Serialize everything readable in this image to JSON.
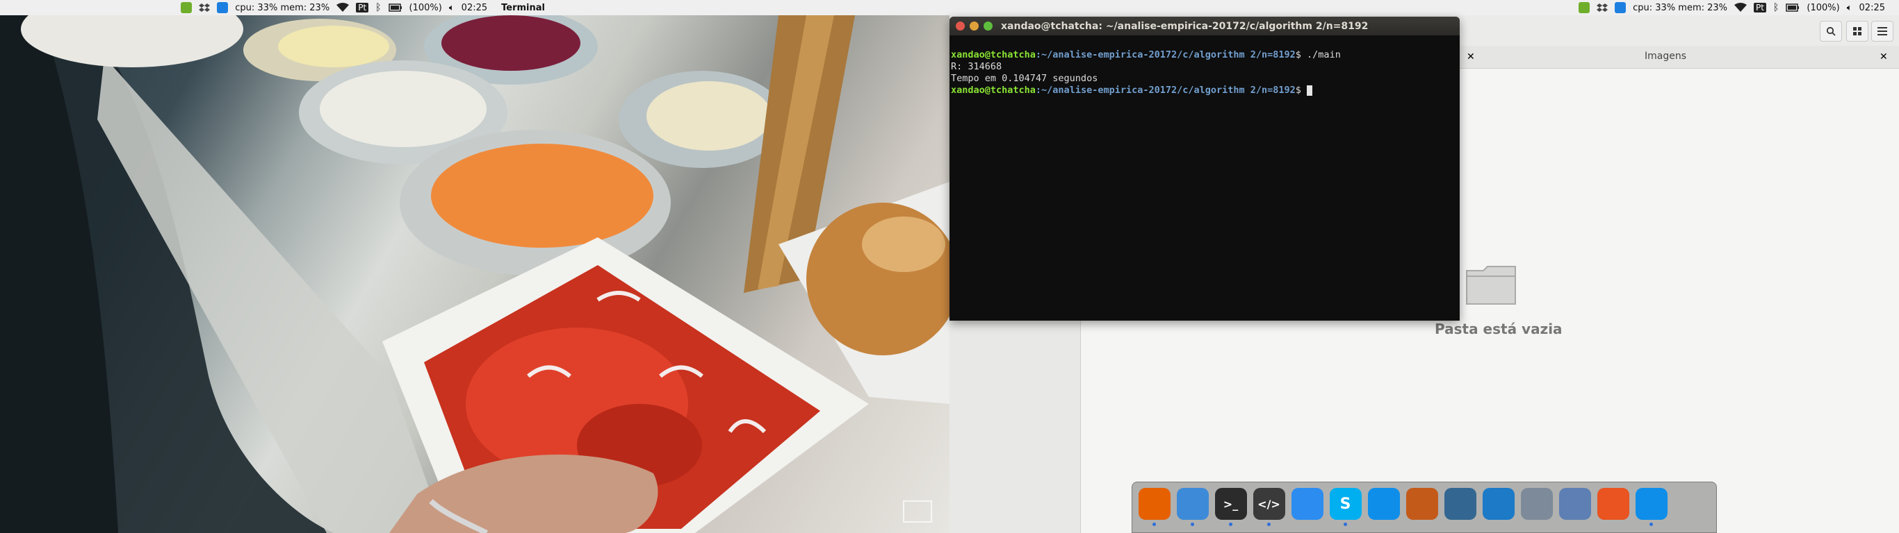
{
  "topbar_left": {
    "cpu_mem": "cpu: 33% mem: 23%",
    "pt_badge": "Pt",
    "battery": "(100%)",
    "clock": "02:25",
    "app_name": "Terminal"
  },
  "topbar_right": {
    "cpu_mem": "cpu: 33% mem: 23%",
    "pt_badge": "Pt",
    "battery": "(100%)",
    "clock": "02:25"
  },
  "terminal": {
    "title": "xandao@tchatcha: ~/analise-empirica-20172/c/algorithm 2/n=8192",
    "lines": [
      {
        "user": "xandao@tchatcha",
        "path": ":~/analise-empirica-20172/c/algorithm 2/n=8192",
        "cmd": "$ ./main"
      },
      {
        "out": "R: 314668"
      },
      {
        "out": "Tempo em 0.104747 segundos"
      },
      {
        "user": "xandao@tchatcha",
        "path": ":~/analise-empirica-20172/c/algorithm 2/n=8192",
        "cmd": "$ "
      }
    ]
  },
  "file_manager": {
    "tab_title": "Imagens",
    "empty_message": "Pasta está vazia"
  },
  "dock": {
    "items": [
      {
        "icon": "firefox-icon",
        "color": "#e66000",
        "glyph": "",
        "running": true
      },
      {
        "icon": "finder-icon",
        "color": "#3d8bd8",
        "glyph": "",
        "running": true
      },
      {
        "icon": "terminal-icon",
        "color": "#2b2b2b",
        "glyph": ">_",
        "running": true
      },
      {
        "icon": "code-editor-icon",
        "color": "#3a3a3a",
        "glyph": "</>",
        "running": true
      },
      {
        "icon": "dropbox-icon",
        "color": "#2c8cf0",
        "glyph": "",
        "running": false
      },
      {
        "icon": "skype-icon",
        "color": "#00aff0",
        "glyph": "S",
        "running": true
      },
      {
        "icon": "teamviewer-icon",
        "color": "#0e8ee9",
        "glyph": "",
        "running": false
      },
      {
        "icon": "matlab-icon",
        "color": "#c45a1a",
        "glyph": "",
        "running": false
      },
      {
        "icon": "postgresql-icon",
        "color": "#336791",
        "glyph": "",
        "running": false
      },
      {
        "icon": "mysql-workbench-icon",
        "color": "#1c7ac7",
        "glyph": "",
        "running": false
      },
      {
        "icon": "scanner-icon",
        "color": "#7d8a99",
        "glyph": "",
        "running": false
      },
      {
        "icon": "virtualbox-icon",
        "color": "#5d7fb3",
        "glyph": "",
        "running": false
      },
      {
        "icon": "ubuntu-software-icon",
        "color": "#e95420",
        "glyph": "",
        "running": false
      },
      {
        "icon": "teamviewer-icon",
        "color": "#0e8ee9",
        "glyph": "",
        "running": true
      }
    ]
  }
}
